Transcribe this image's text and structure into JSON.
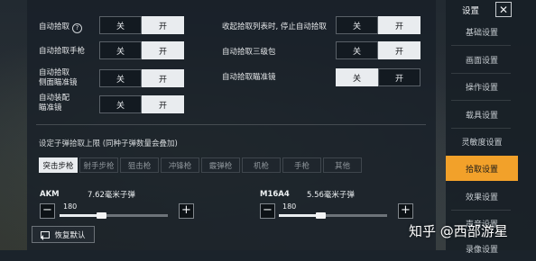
{
  "toggles": [
    {
      "label": "自动拾取",
      "help": "?",
      "off": "关",
      "on": "开",
      "active": "on"
    },
    {
      "label": "自动拾取手枪",
      "off": "关",
      "on": "开",
      "active": "on"
    },
    {
      "label_line1": "自动拾取",
      "label_line2": "侧面瞄准镜",
      "off": "关",
      "on": "开",
      "active": "on"
    },
    {
      "label_line1": "自动装配",
      "label_line2": "瞄准镜",
      "off": "关",
      "on": "开",
      "active": "on"
    },
    {
      "label": "收起拾取列表时, 停止自动拾取",
      "off": "关",
      "on": "开",
      "active": "on"
    },
    {
      "label": "自动拾取三级包",
      "off": "关",
      "on": "开",
      "active": "on"
    },
    {
      "label": "自动拾取瞄准镜",
      "off": "关",
      "on": "开",
      "active": "off"
    }
  ],
  "ammo_note": "设定子弹拾取上限 (同种子弹数量会叠加)",
  "weapon_tabs": [
    "突击步枪",
    "射手步枪",
    "狙击枪",
    "冲锋枪",
    "霰弹枪",
    "机枪",
    "手枪",
    "其他"
  ],
  "active_tab": "突击步枪",
  "weapons": [
    {
      "name": "AKM",
      "ammo": "7.62毫米子弹",
      "value": "180",
      "minus": "−",
      "plus": "+",
      "fraction": 0.38
    },
    {
      "name": "M16A4",
      "ammo": "5.56毫米子弹",
      "value": "180",
      "minus": "−",
      "plus": "+",
      "fraction": 0.38
    }
  ],
  "reset_label": "恢复默认",
  "sidebar": {
    "title": "设置",
    "close": "✕",
    "items": [
      "基础设置",
      "画面设置",
      "操作设置",
      "载具设置",
      "灵敏度设置",
      "拾取设置",
      "效果设置",
      "声音设置",
      "录像设置"
    ],
    "active": "拾取设置"
  },
  "watermark": "知乎 @西部游星",
  "colors": {
    "accent": "#f2a12a",
    "toggle_on": "#e9ecef",
    "toggle_off": "#131a21"
  }
}
